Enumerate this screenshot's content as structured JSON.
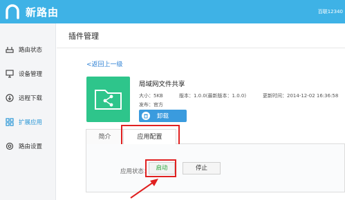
{
  "header": {
    "logo_text": "新路由",
    "account_text": "百联12340",
    "bar_color": "#3eb2e6"
  },
  "sidebar": {
    "items": [
      {
        "label": "路由状态",
        "icon": "router-status-icon",
        "active": false
      },
      {
        "label": "设备管理",
        "icon": "device-monitor-icon",
        "active": false
      },
      {
        "label": "远程下载",
        "icon": "download-icon",
        "active": false
      },
      {
        "label": "扩展应用",
        "icon": "apps-grid-icon",
        "active": true
      },
      {
        "label": "路由设置",
        "icon": "settings-gear-icon",
        "active": false
      }
    ]
  },
  "main": {
    "title": "插件管理",
    "back_link": "<返回上一级",
    "plugin": {
      "name": "局域网文件共享",
      "size": "大小：5KB",
      "version": "版本：1.0.0(最新版本：1.0.0)",
      "updated": "更新时间：2014-12-02 16:36:58",
      "publisher": "发布：官方",
      "uninstall_label": "卸载",
      "icon": "folder-share-icon",
      "icon_color": "#2ec58b"
    },
    "tabs": [
      {
        "label": "简介",
        "active": false
      },
      {
        "label": "应用配置",
        "active": true
      }
    ],
    "config": {
      "status_label": "应用状态：",
      "start_label": "启动",
      "stop_label": "停止"
    }
  },
  "colors": {
    "accent": "#3a9bde",
    "highlight": "#e02020",
    "start_text": "#2aa53a",
    "link": "#2b7fd4"
  }
}
